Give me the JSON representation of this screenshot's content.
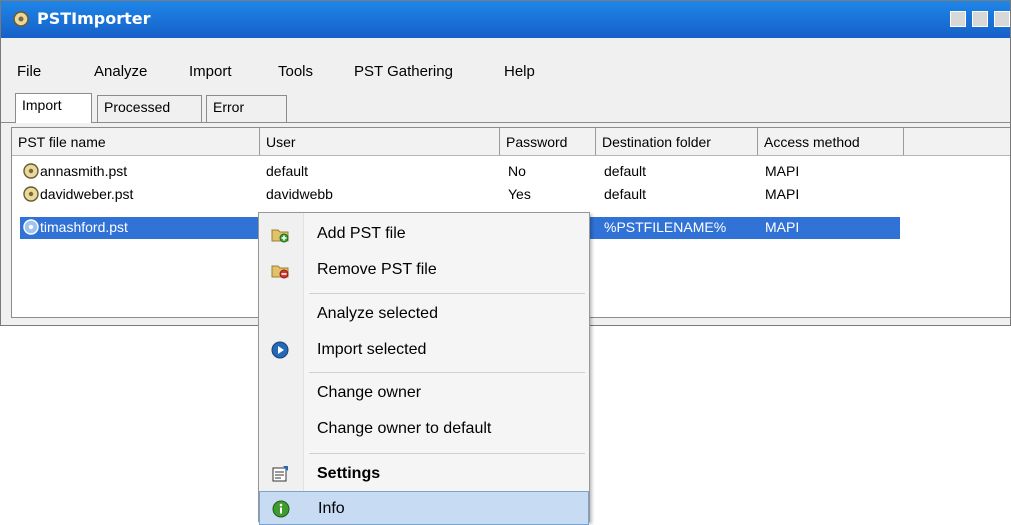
{
  "window": {
    "title": "PSTImporter"
  },
  "menu": [
    "File",
    "Analyze",
    "Import",
    "Tools",
    "PST Gathering",
    "Help"
  ],
  "tabs": [
    "Import",
    "Processed",
    "Error"
  ],
  "columns": [
    "PST file name",
    "User",
    "Password",
    "Destination folder",
    "Access method"
  ],
  "rows": [
    {
      "file": "annasmith.pst",
      "user": "default",
      "password": "No",
      "dest": "default",
      "method": "MAPI"
    },
    {
      "file": "davidweber.pst",
      "user": "davidwebb",
      "password": "Yes",
      "dest": "default",
      "method": "MAPI"
    },
    {
      "file": "timashford.pst",
      "user": "",
      "password": "",
      "dest": "%PSTFILENAME%",
      "method": "MAPI"
    }
  ],
  "context_menu": {
    "items": [
      {
        "label": "Add PST file",
        "icon": "add-folder-icon"
      },
      {
        "label": "Remove PST file",
        "icon": "remove-folder-icon"
      },
      {
        "label": "Analyze selected",
        "icon": ""
      },
      {
        "label": "Import selected",
        "icon": "play-icon"
      },
      {
        "label": "Change owner",
        "icon": ""
      },
      {
        "label": "Change owner to default",
        "icon": ""
      },
      {
        "label": "Settings",
        "icon": "settings-icon"
      },
      {
        "label": "Info",
        "icon": "info-icon"
      }
    ]
  },
  "colors": {
    "title_bar": "#1560c8",
    "selection": "#3072d6",
    "menu_hover": "#c7dcf3"
  }
}
